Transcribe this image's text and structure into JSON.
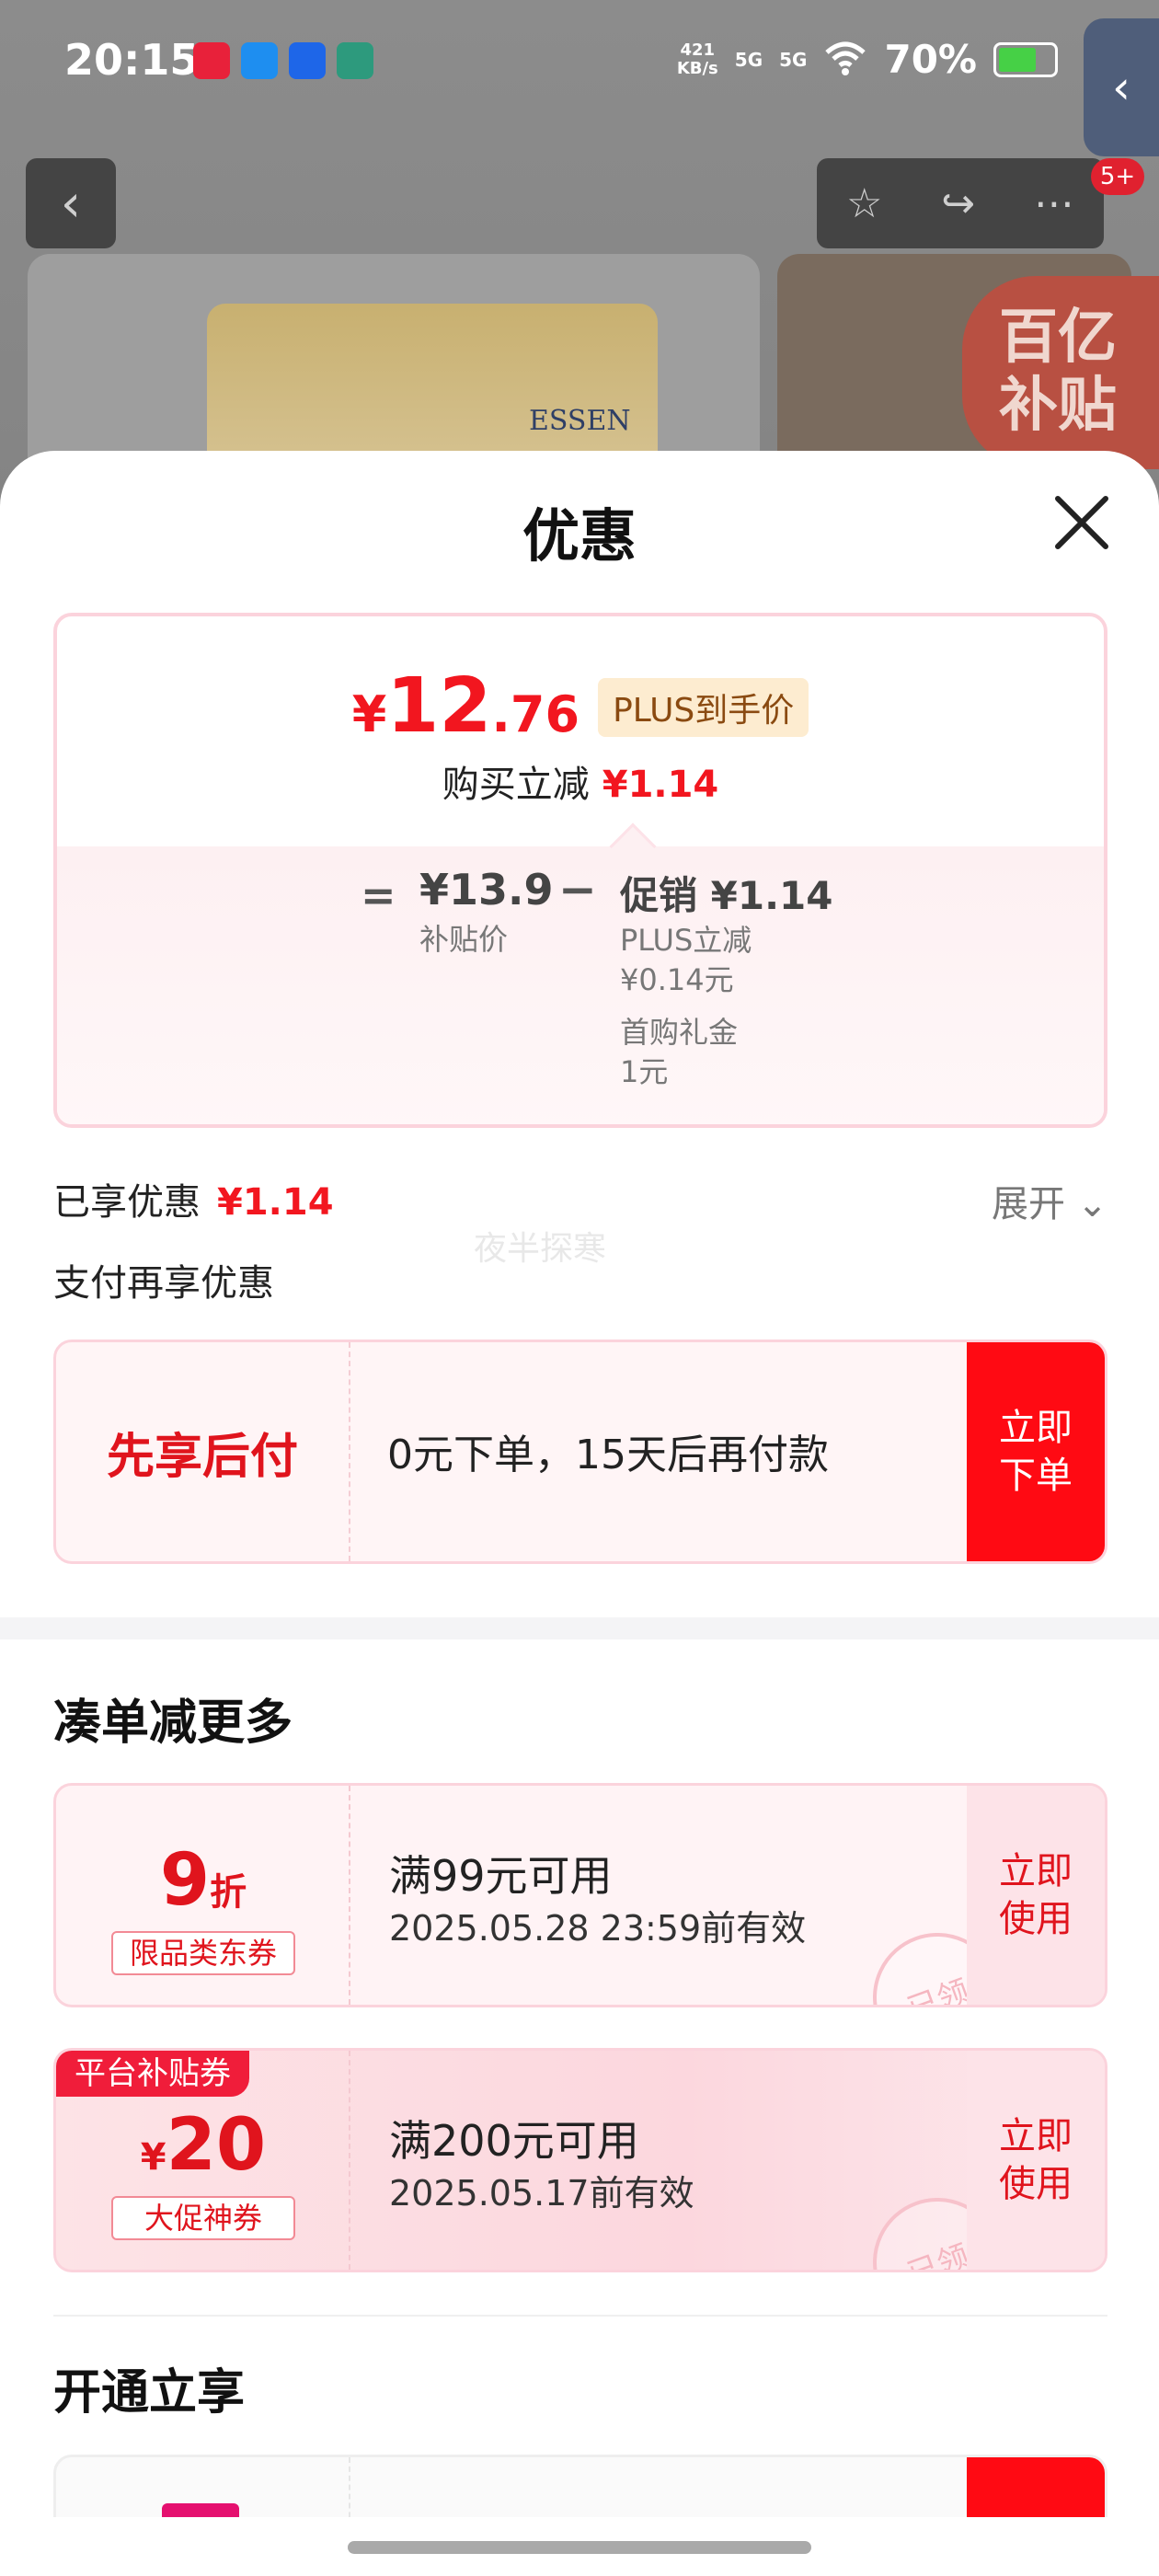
{
  "status_bar": {
    "time": "20:15",
    "net_speed_value": "421",
    "net_speed_unit": "KB/s",
    "signal_1": "5G",
    "signal_2": "5G",
    "battery_percent": "70%",
    "app_icon_colors": [
      "#e8213a",
      "#1e8ef0",
      "#1e66e8",
      "#2d9a7d"
    ]
  },
  "background": {
    "back_icon": "chevron-left-icon",
    "star_icon": "star-icon",
    "share_icon": "share-icon",
    "more_icon": "more-icon",
    "badge": "5+",
    "brand_on_bag": "ESSEN",
    "subsidy_tag": "百亿补贴"
  },
  "sheet": {
    "title": "优惠",
    "close_icon": "close-icon"
  },
  "price_card": {
    "currency": "¥",
    "price_int": "12",
    "price_dec": ".76",
    "plus_label": "PLUS到手价",
    "reduce_label": "购买立减",
    "reduce_amount": "¥1.14",
    "equals": "=",
    "base_price": "¥13.9",
    "base_label": "补贴价",
    "minus": "−",
    "promo_head": "促销 ¥1.14",
    "promo_line1": "PLUS立减",
    "promo_line2": "¥0.14元",
    "promo_line3": "首购礼金",
    "promo_line4": "1元"
  },
  "enjoyed": {
    "label": "已享优惠",
    "amount": "¥1.14",
    "expand": "展开 ⌄"
  },
  "watermark": "夜半探寒",
  "pay_more": "支付再享优惠",
  "bnpl": {
    "title": "先享后付",
    "text": "0元下单，15天后再付款",
    "button": "立即下单"
  },
  "section_bundle": "凑单减更多",
  "coupons": [
    {
      "value": "9",
      "unit": "折",
      "type": "限品类东券",
      "condition": "满99元可用",
      "expiry": "2025.05.28 23:59前有效",
      "button": "立即使用",
      "stamp": "已领"
    },
    {
      "tag": "平台补贴券",
      "currency": "¥",
      "value": "20",
      "type": "大促神券",
      "condition": "满200元可用",
      "expiry": "2025.05.17前有效",
      "button": "立即使用",
      "stamp": "已领"
    }
  ],
  "section_open": "开通立享",
  "colors": {
    "accent_red": "#f2161f",
    "button_red": "#ff0a13",
    "plus_bg": "#fdecd0",
    "card_border": "#fbd3dc"
  }
}
